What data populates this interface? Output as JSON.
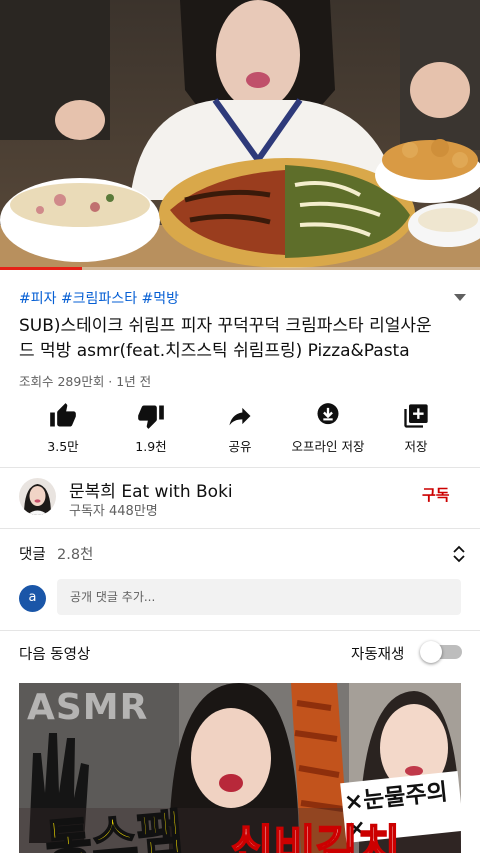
{
  "player": {
    "progress": 0.17,
    "colors": {
      "progress": "#e62117"
    }
  },
  "video": {
    "hashtags": "#피자 #크림파스타 #먹방",
    "title": "SUB)스테이크 쉬림프 피자 꾸덕꾸덕 크림파스타 리얼사운드 먹방 asmr(feat.치즈스틱 쉬림프링) Pizza&Pasta",
    "meta": "조회수 289만회 · 1년 전"
  },
  "actions": [
    {
      "label": "3.5만",
      "icon": "thumbs-up-icon"
    },
    {
      "label": "1.9천",
      "icon": "thumbs-down-icon"
    },
    {
      "label": "공유",
      "icon": "share-icon"
    },
    {
      "label": "오프라인 저장",
      "icon": "download-icon"
    },
    {
      "label": "저장",
      "icon": "playlist-add-icon"
    }
  ],
  "channel": {
    "name": "문복희 Eat with Boki",
    "subscribers": "구독자 448만명",
    "subscribe_label": "구독"
  },
  "comments": {
    "label": "댓글",
    "count": "2.8천",
    "user_initial": "a",
    "placeholder": "공개 댓글 추가..."
  },
  "upnext": {
    "label": "다음 동영상",
    "autoplay_label": "자동재생",
    "autoplay_on": false,
    "thumbnail": {
      "badge": "ASMR",
      "warning": "×눈물주의×",
      "headline_left": "통스팸",
      "headline_right": "신비김치"
    }
  },
  "colors": {
    "accent": "#cc0000",
    "link": "#065fd4",
    "text_secondary": "#606060"
  }
}
